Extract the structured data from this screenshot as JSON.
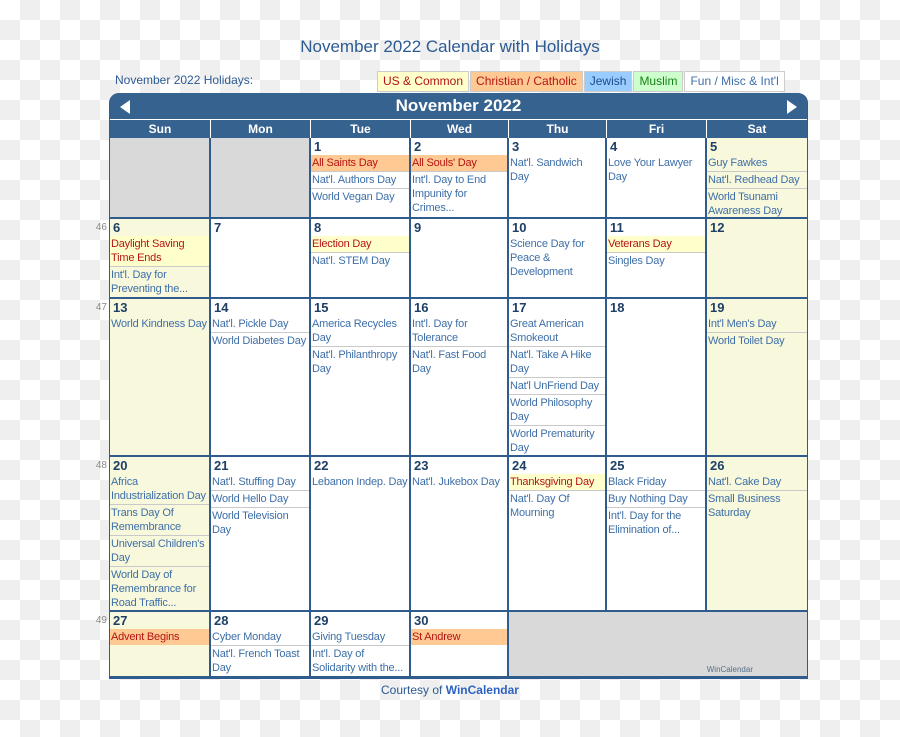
{
  "page": {
    "title": "November 2022 Calendar with Holidays",
    "holidays_label": "November 2022 Holidays:",
    "courtesy_prefix": "Courtesy of ",
    "courtesy_link": "WinCalendar"
  },
  "legend": [
    {
      "label": "US & Common",
      "type": "us",
      "bg": "#ffffcc"
    },
    {
      "label": "Christian / Catholic",
      "type": "chr",
      "bg": "#ffc993"
    },
    {
      "label": "Jewish",
      "type": "jew",
      "bg": "#99ccff"
    },
    {
      "label": "Muslim",
      "type": "mus",
      "bg": "#ccffcc"
    },
    {
      "label": "Fun / Misc & Int'l",
      "type": "fun",
      "bg": "#ffffff"
    }
  ],
  "calendar": {
    "month_label": "November 2022",
    "prev_icon": "triangle-left-icon",
    "next_icon": "triangle-right-icon",
    "days_of_week": [
      "Sun",
      "Mon",
      "Tue",
      "Wed",
      "Thu",
      "Fri",
      "Sat"
    ],
    "watermark": "WinCalendar",
    "weeks": [
      {
        "week_number": "",
        "days": [
          {
            "empty": true
          },
          {
            "empty": true
          },
          {
            "day": "1",
            "events": [
              {
                "t": "All Saints Day",
                "type": "chr"
              },
              {
                "t": "Nat'l. Authors Day",
                "type": "fun"
              },
              {
                "t": "World Vegan Day",
                "type": "fun"
              }
            ]
          },
          {
            "day": "2",
            "events": [
              {
                "t": "All Souls' Day",
                "type": "chr"
              },
              {
                "t": "Int'l. Day to End Impunity for Crimes...",
                "type": "fun"
              }
            ]
          },
          {
            "day": "3",
            "events": [
              {
                "t": "Nat'l. Sandwich Day",
                "type": "fun"
              }
            ]
          },
          {
            "day": "4",
            "events": [
              {
                "t": "Love Your Lawyer Day",
                "type": "fun"
              }
            ]
          },
          {
            "day": "5",
            "weekend": true,
            "events": [
              {
                "t": "Guy Fawkes",
                "type": "fun"
              },
              {
                "t": "Nat'l. Redhead Day",
                "type": "fun"
              },
              {
                "t": "World Tsunami Awareness Day",
                "type": "fun"
              }
            ]
          }
        ]
      },
      {
        "week_number": "46",
        "days": [
          {
            "day": "6",
            "weekend": true,
            "events": [
              {
                "t": "Daylight Saving Time Ends",
                "type": "us"
              },
              {
                "t": "Int'l. Day for Preventing the...",
                "type": "fun"
              }
            ]
          },
          {
            "day": "7",
            "events": []
          },
          {
            "day": "8",
            "events": [
              {
                "t": "Election Day",
                "type": "us"
              },
              {
                "t": "Nat'l. STEM Day",
                "type": "fun"
              }
            ]
          },
          {
            "day": "9",
            "events": []
          },
          {
            "day": "10",
            "events": [
              {
                "t": "Science Day for Peace & Development",
                "type": "fun"
              }
            ]
          },
          {
            "day": "11",
            "events": [
              {
                "t": "Veterans Day",
                "type": "us"
              },
              {
                "t": "Singles Day",
                "type": "fun"
              }
            ]
          },
          {
            "day": "12",
            "weekend": true,
            "events": []
          }
        ]
      },
      {
        "week_number": "47",
        "days": [
          {
            "day": "13",
            "weekend": true,
            "events": [
              {
                "t": "World Kindness Day",
                "type": "fun"
              }
            ]
          },
          {
            "day": "14",
            "events": [
              {
                "t": "Nat'l. Pickle Day",
                "type": "fun"
              },
              {
                "t": "World Diabetes Day",
                "type": "fun"
              }
            ]
          },
          {
            "day": "15",
            "events": [
              {
                "t": "America Recycles Day",
                "type": "fun"
              },
              {
                "t": "Nat'l. Philanthropy Day",
                "type": "fun"
              }
            ]
          },
          {
            "day": "16",
            "events": [
              {
                "t": "Int'l. Day for Tolerance",
                "type": "fun"
              },
              {
                "t": "Nat'l. Fast Food Day",
                "type": "fun"
              }
            ]
          },
          {
            "day": "17",
            "events": [
              {
                "t": "Great American Smokeout",
                "type": "fun"
              },
              {
                "t": "Nat'l. Take A Hike Day",
                "type": "fun"
              },
              {
                "t": "Nat'l UnFriend Day",
                "type": "fun"
              },
              {
                "t": "World Philosophy Day",
                "type": "fun"
              },
              {
                "t": "World Prematurity Day",
                "type": "fun"
              }
            ]
          },
          {
            "day": "18",
            "events": []
          },
          {
            "day": "19",
            "weekend": true,
            "events": [
              {
                "t": "Int'l Men's Day",
                "type": "fun"
              },
              {
                "t": "World Toilet Day",
                "type": "fun"
              }
            ]
          }
        ]
      },
      {
        "week_number": "48",
        "days": [
          {
            "day": "20",
            "weekend": true,
            "events": [
              {
                "t": "Africa Industrialization Day",
                "type": "fun"
              },
              {
                "t": "Trans Day Of Remembrance",
                "type": "fun"
              },
              {
                "t": "Universal Children's Day",
                "type": "fun"
              },
              {
                "t": "World Day of Remembrance for Road Traffic...",
                "type": "fun"
              }
            ]
          },
          {
            "day": "21",
            "events": [
              {
                "t": "Nat'l. Stuffing Day",
                "type": "fun"
              },
              {
                "t": "World Hello Day",
                "type": "fun"
              },
              {
                "t": "World Television Day",
                "type": "fun"
              }
            ]
          },
          {
            "day": "22",
            "events": [
              {
                "t": "Lebanon Indep. Day",
                "type": "fun"
              }
            ]
          },
          {
            "day": "23",
            "events": [
              {
                "t": "Nat'l. Jukebox Day",
                "type": "fun"
              }
            ]
          },
          {
            "day": "24",
            "events": [
              {
                "t": "Thanksgiving Day",
                "type": "us"
              },
              {
                "t": "Nat'l. Day Of Mourning",
                "type": "fun"
              }
            ]
          },
          {
            "day": "25",
            "events": [
              {
                "t": "Black Friday",
                "type": "fun"
              },
              {
                "t": "Buy Nothing Day",
                "type": "fun"
              },
              {
                "t": "Int'l. Day for the Elimination of...",
                "type": "fun"
              }
            ]
          },
          {
            "day": "26",
            "weekend": true,
            "events": [
              {
                "t": "Nat'l. Cake Day",
                "type": "fun"
              },
              {
                "t": "Small Business Saturday",
                "type": "fun"
              }
            ]
          }
        ]
      },
      {
        "week_number": "49",
        "days": [
          {
            "day": "27",
            "weekend": true,
            "events": [
              {
                "t": "Advent Begins",
                "type": "chr"
              }
            ]
          },
          {
            "day": "28",
            "events": [
              {
                "t": "Cyber Monday",
                "type": "fun"
              },
              {
                "t": "Nat'l. French Toast Day",
                "type": "fun"
              }
            ]
          },
          {
            "day": "29",
            "events": [
              {
                "t": "Giving Tuesday",
                "type": "fun"
              },
              {
                "t": "Int'l. Day of Solidarity with the...",
                "type": "fun"
              }
            ]
          },
          {
            "day": "30",
            "events": [
              {
                "t": "St Andrew",
                "type": "chr"
              }
            ]
          },
          {
            "empty": true,
            "span": 3,
            "watermark": true
          }
        ]
      }
    ]
  }
}
